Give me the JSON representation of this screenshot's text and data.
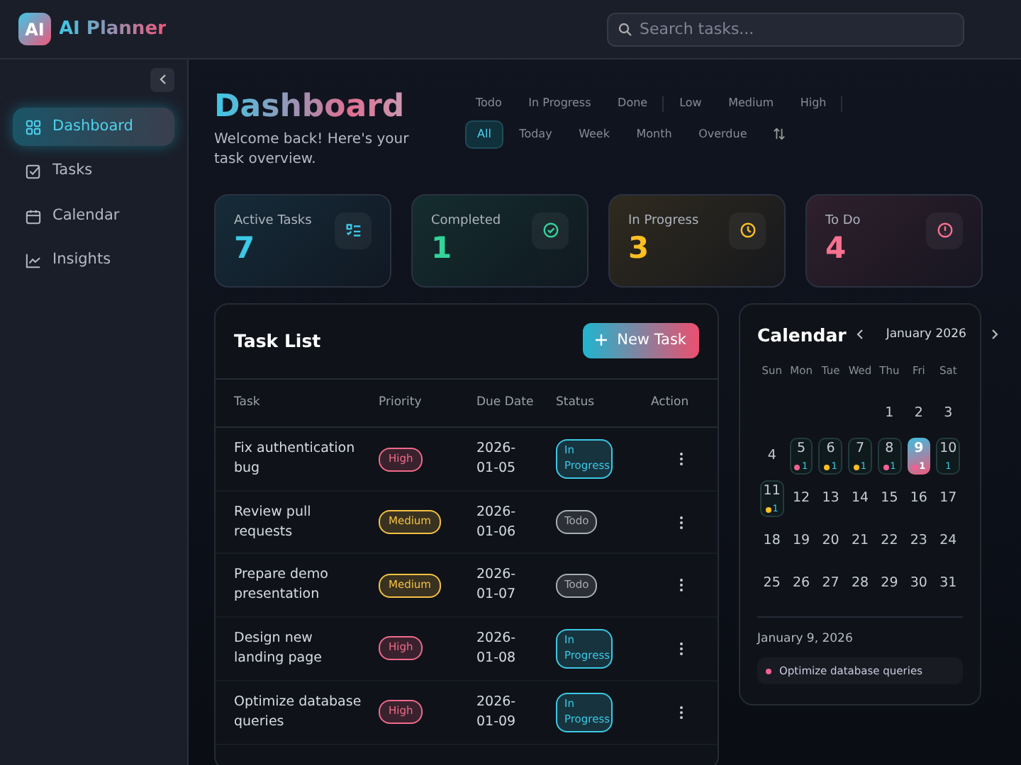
{
  "app": {
    "logo": "AI",
    "title": "AI Planner"
  },
  "search": {
    "placeholder": "Search tasks..."
  },
  "sidebar": {
    "items": [
      {
        "label": "Dashboard",
        "selected": true
      },
      {
        "label": "Tasks",
        "selected": false
      },
      {
        "label": "Calendar",
        "selected": false
      },
      {
        "label": "Insights",
        "selected": false
      }
    ]
  },
  "header": {
    "title": "Dashboard",
    "subtitle": "Welcome back! Here's your task overview."
  },
  "filters": {
    "status": [
      {
        "label": "Todo",
        "selected": false
      },
      {
        "label": "In Progress",
        "selected": false
      },
      {
        "label": "Done",
        "selected": false
      }
    ],
    "priority": [
      {
        "label": "Low",
        "selected": false
      },
      {
        "label": "Medium",
        "selected": false
      },
      {
        "label": "High",
        "selected": false
      }
    ],
    "range": [
      {
        "label": "All",
        "selected": true
      },
      {
        "label": "Today",
        "selected": false
      },
      {
        "label": "Week",
        "selected": false
      },
      {
        "label": "Month",
        "selected": false
      },
      {
        "label": "Overdue",
        "selected": false
      }
    ]
  },
  "stats": [
    {
      "label": "Active Tasks",
      "value": "7",
      "color": "#3cc8e6"
    },
    {
      "label": "Completed",
      "value": "1",
      "color": "#34d399"
    },
    {
      "label": "In Progress",
      "value": "3",
      "color": "#fbbf24"
    },
    {
      "label": "To Do",
      "value": "4",
      "color": "#f8718f"
    }
  ],
  "task_list": {
    "title": "Task List",
    "new_button": "New Task",
    "columns": [
      "Task",
      "Priority",
      "Due Date",
      "Status",
      "Action"
    ],
    "rows": [
      {
        "task": "Fix authentication bug",
        "priority": {
          "label": "High",
          "color": "#f06a8a"
        },
        "due": "2026-01-05",
        "status": {
          "label": "In Progress",
          "color": "#3cc8e6"
        }
      },
      {
        "task": "Review pull requests",
        "priority": {
          "label": "Medium",
          "color": "#f4c144"
        },
        "due": "2026-01-06",
        "status": {
          "label": "Todo",
          "color": "#a8adb7"
        }
      },
      {
        "task": "Prepare demo presentation",
        "priority": {
          "label": "Medium",
          "color": "#f4c144"
        },
        "due": "2026-01-07",
        "status": {
          "label": "Todo",
          "color": "#a8adb7"
        }
      },
      {
        "task": "Design new landing page",
        "priority": {
          "label": "High",
          "color": "#f06a8a"
        },
        "due": "2026-01-08",
        "status": {
          "label": "In Progress",
          "color": "#3cc8e6"
        }
      },
      {
        "task": "Optimize database queries",
        "priority": {
          "label": "High",
          "color": "#f06a8a"
        },
        "due": "2026-01-09",
        "status": {
          "label": "In Progress",
          "color": "#3cc8e6"
        }
      }
    ]
  },
  "calendar": {
    "title": "Calendar",
    "month": "January 2026",
    "weekdays": [
      "Sun",
      "Mon",
      "Tue",
      "Wed",
      "Thu",
      "Fri",
      "Sat"
    ],
    "weeks": [
      [
        {
          "day": "1"
        },
        {
          "day": "2"
        },
        {
          "day": "3"
        }
      ],
      [
        {
          "day": "4"
        },
        {
          "day": "5",
          "count": "1",
          "color": "#f06292",
          "selected": false
        },
        {
          "day": "6",
          "count": "1",
          "color": "#fbbf24",
          "selected": false
        },
        {
          "day": "7",
          "count": "1",
          "color": "#fbbf24",
          "selected": false
        },
        {
          "day": "8",
          "count": "1",
          "color": "#f06292",
          "selected": false
        },
        {
          "day": "9",
          "count": "1",
          "color": "#f06292",
          "selected": true
        },
        {
          "day": "10",
          "count": "1",
          "selected": false
        }
      ],
      [
        {
          "day": "11",
          "count": "1",
          "color": "#fbbf24",
          "selected": false
        },
        {
          "day": "12"
        },
        {
          "day": "13"
        },
        {
          "day": "14"
        },
        {
          "day": "15"
        },
        {
          "day": "16"
        },
        {
          "day": "17"
        }
      ],
      [
        {
          "day": "18"
        },
        {
          "day": "19"
        },
        {
          "day": "20"
        },
        {
          "day": "21"
        },
        {
          "day": "22"
        },
        {
          "day": "23"
        },
        {
          "day": "24"
        }
      ],
      [
        {
          "day": "25"
        },
        {
          "day": "26"
        },
        {
          "day": "27"
        },
        {
          "day": "28"
        },
        {
          "day": "29"
        },
        {
          "day": "30"
        },
        {
          "day": "31"
        }
      ]
    ],
    "selected_date": "January 9, 2026",
    "events": [
      {
        "title": "Optimize database queries",
        "color": "#f06292"
      }
    ]
  }
}
